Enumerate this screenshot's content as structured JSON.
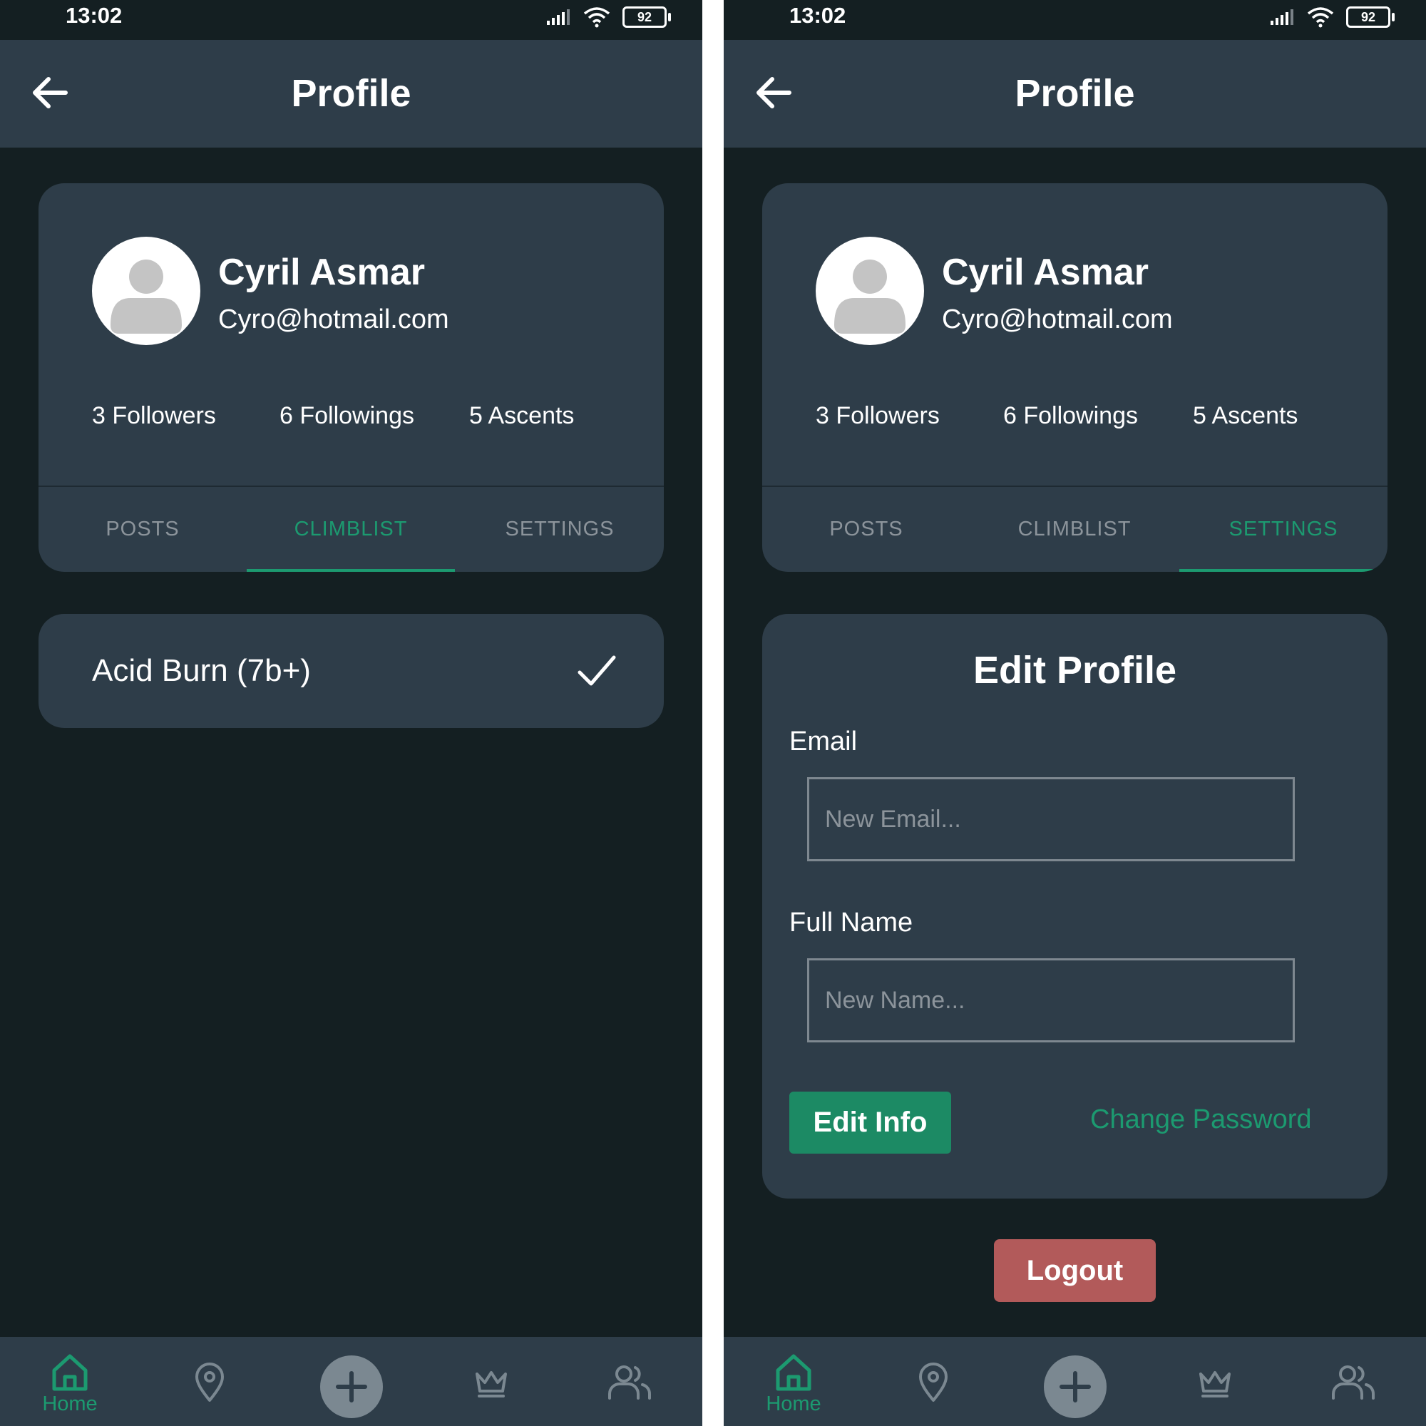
{
  "status_bar": {
    "time": "13:02",
    "battery": "92"
  },
  "app_bar": {
    "title": "Profile"
  },
  "profile": {
    "name": "Cyril Asmar",
    "email": "Cyro@hotmail.com",
    "followers": "3 Followers",
    "followings": "6 Followings",
    "ascents": "5 Ascents"
  },
  "tabs": [
    {
      "label": "POSTS"
    },
    {
      "label": "CLIMBLIST"
    },
    {
      "label": "SETTINGS"
    }
  ],
  "climblist": [
    {
      "name": "Acid Burn (7b+)",
      "status_icon": "check-icon"
    }
  ],
  "settings": {
    "title": "Edit Profile",
    "email_label": "Email",
    "email_placeholder": "New Email...",
    "name_label": "Full Name",
    "name_placeholder": "New Name...",
    "edit_button": "Edit Info",
    "change_password": "Change Password",
    "logout": "Logout"
  },
  "bottom_nav": {
    "items": [
      {
        "icon": "home-icon",
        "label": "Home",
        "active": true
      },
      {
        "icon": "map-pin-icon"
      },
      {
        "icon": "plus-icon"
      },
      {
        "icon": "crown-icon"
      },
      {
        "icon": "users-icon"
      }
    ]
  },
  "colors": {
    "background": "#141f22",
    "surface": "#2e3d49",
    "accent": "#1c9a70",
    "button_green": "#1c8a64",
    "logout_red": "#b25a5a",
    "muted_text": "#8c949b"
  }
}
